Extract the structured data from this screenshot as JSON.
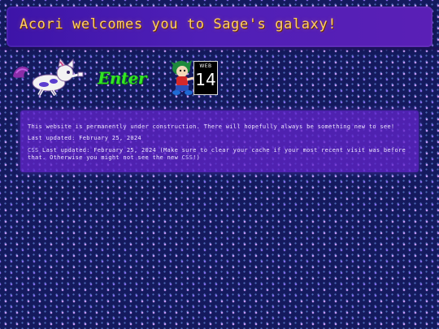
{
  "header": {
    "title": "Acori welcomes you to Sage's galaxy!"
  },
  "buttons": {
    "acori_alt": "Acori sprite",
    "enter_label": "Enter",
    "web_badge_top": "WEB",
    "web_badge_number": "14"
  },
  "content": {
    "construction_text": "This website is permanently under construction. There will hopefully always be something new to see!",
    "last_updated": "Last updated: February 25, 2024",
    "css_link": "CSS",
    "css_updated_text": " Last updated: February 25, 2024 (Make sure to clear your cache if your most recent visit was before that. Otherwise you might not see the new ",
    "css_link_2": "CSS",
    "css_updated_tail": "!)"
  },
  "colors": {
    "background": "#141a5e",
    "header_gradient_start": "#3d14a8",
    "header_title": "#ffcf67",
    "content_box": "#6024c8",
    "enter_text": "#32e624",
    "star_primary": "#cea0ff"
  }
}
